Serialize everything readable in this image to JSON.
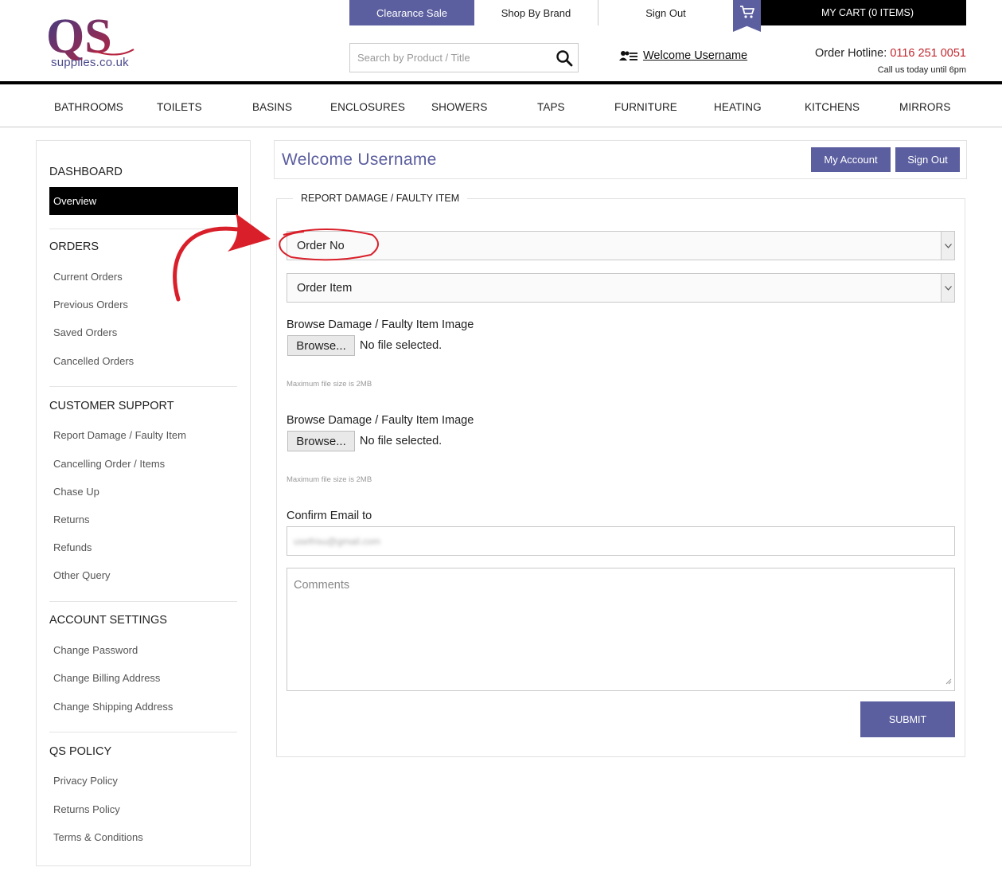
{
  "header": {
    "logo_text": "supplies.co.uk",
    "logo_letters": "QS",
    "top_nav": [
      "Clearance Sale",
      "Shop By Brand",
      "Sign Out"
    ],
    "cart_label": "MY CART (0 ITEMS)",
    "search_placeholder": "Search by Product / Title",
    "welcome_link": "Welcome Username",
    "hotline_label": "Order Hotline:",
    "hotline_number": "0116 251 0051",
    "hours": "Call us today until 6pm"
  },
  "categories": [
    "BATHROOMS",
    "TOILETS",
    "BASINS",
    "ENCLOSURES",
    "SHOWERS",
    "TAPS",
    "FURNITURE",
    "HEATING",
    "KITCHENS",
    "MIRRORS"
  ],
  "sidebar": {
    "dashboard": "DASHBOARD",
    "overview": "Overview",
    "orders_head": "ORDERS",
    "orders": [
      "Current Orders",
      "Previous Orders",
      "Saved Orders",
      "Cancelled Orders"
    ],
    "support_head": "CUSTOMER SUPPORT",
    "support": [
      "Report Damage / Faulty Item",
      "Cancelling Order / Items",
      "Chase Up",
      "Returns",
      "Refunds",
      "Other Query"
    ],
    "account_head": "ACCOUNT SETTINGS",
    "account": [
      "Change Password",
      "Change Billing Address",
      "Change Shipping Address"
    ],
    "policy_head": "QS POLICY",
    "policy": [
      "Privacy Policy",
      "Returns Policy",
      "Terms & Conditions"
    ]
  },
  "main": {
    "welcome_title": "Welcome Username",
    "my_account": "My Account",
    "sign_out": "Sign Out",
    "form_title": "REPORT DAMAGE / FAULTY ITEM",
    "order_no": "Order No",
    "order_item": "Order Item",
    "browse_label": "Browse Damage / Faulty Item Image",
    "browse_button": "Browse...",
    "no_file": "No file selected.",
    "max_size": "Maximum file size is 2MB",
    "confirm_email_label": "Confirm Email to",
    "email_value": "usefrisu@gmail.com",
    "comments_placeholder": "Comments",
    "submit": "SUBMIT"
  },
  "colors": {
    "accent": "#5b5e9f",
    "hotline": "#c0272d",
    "annotation": "#d9202a"
  }
}
